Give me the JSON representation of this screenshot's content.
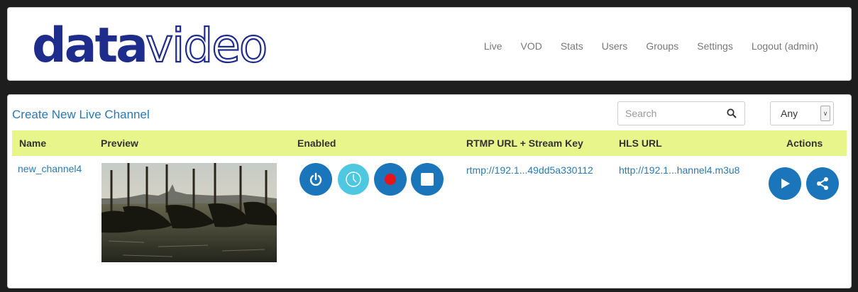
{
  "brand": {
    "logo_text_bold": "data",
    "logo_text_outline": "video",
    "logo_color": "#1e2c8c"
  },
  "nav": {
    "items": [
      "Live",
      "VOD",
      "Stats",
      "Users",
      "Groups",
      "Settings",
      "Logout (admin)"
    ]
  },
  "toolbar": {
    "create_label": "Create New Live Channel",
    "search_placeholder": "Search",
    "filter_value": "Any"
  },
  "table": {
    "columns": [
      "Name",
      "Preview",
      "Enabled",
      "RTMP URL + Stream Key",
      "HLS URL",
      "Actions"
    ],
    "header_color": "#e8f58a",
    "rows": [
      {
        "name": "new_channel4",
        "rtmp": "rtmp://192.1...49dd5a330112",
        "hls": "http://192.1...hannel4.m3u8",
        "controls": [
          "power-icon",
          "clock-icon",
          "record-icon",
          "stop-icon"
        ],
        "actions": [
          "play-icon",
          "share-icon"
        ]
      }
    ]
  },
  "colors": {
    "button_blue": "#1b75bb",
    "clock_cyan": "#4ec7e0",
    "record_red": "#e8141c",
    "link": "#2a7ab3"
  }
}
